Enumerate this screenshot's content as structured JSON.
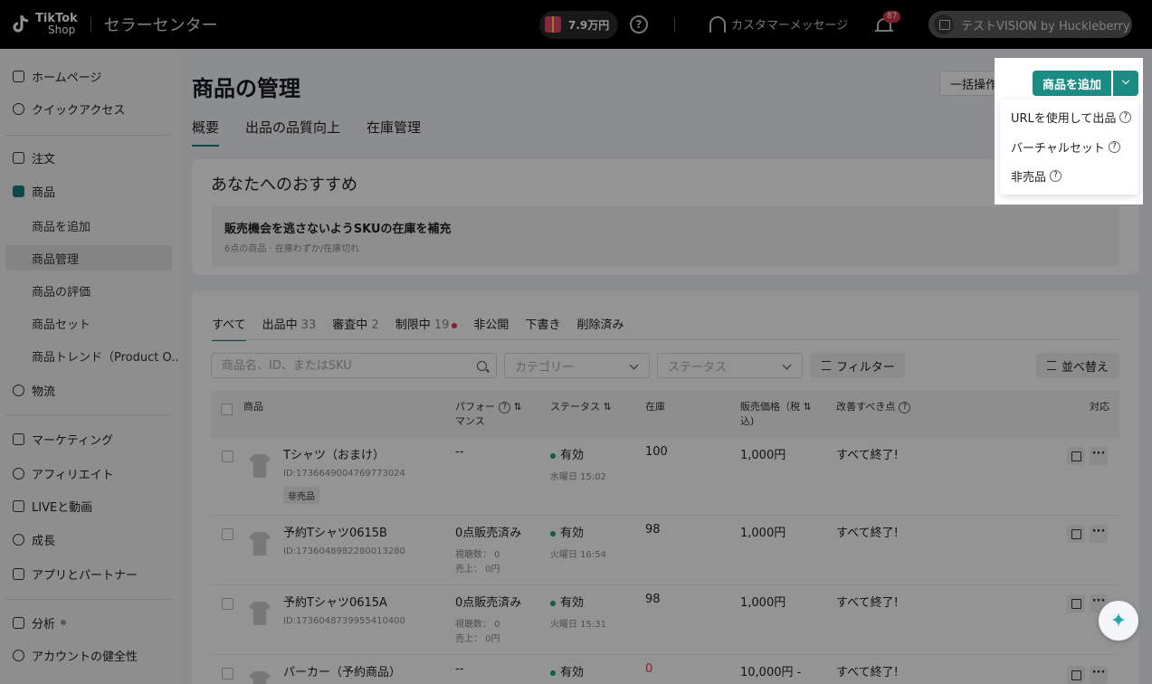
{
  "topbar": {
    "logo_line1": "TikTok",
    "logo_line2": "Shop",
    "center_title": "セラーセンター",
    "balance": "7.9万円",
    "help": "?",
    "customer_messages": "カスタマーメッセージ",
    "notification_count": "87",
    "shop_name": "テストVISION by Huckleberry"
  },
  "sidebar": {
    "home": "ホームページ",
    "quick_access": "クイックアクセス",
    "orders": "注文",
    "products": "商品",
    "sub": {
      "add": "商品を追加",
      "manage": "商品管理",
      "reviews": "商品の評価",
      "sets": "商品セット",
      "trends": "商品トレンド（Product O..."
    },
    "logistics": "物流",
    "marketing": "マーケティング",
    "affiliate": "アフィリエイト",
    "live": "LIVEと動画",
    "growth": "成長",
    "apps": "アプリとパートナー",
    "analytics": "分析",
    "account_health": "アカウントの健全性"
  },
  "main": {
    "title": "商品の管理",
    "bulk_action": "一括操作",
    "add_product": "商品を追加",
    "tabs": [
      "概要",
      "出品の品質向上",
      "在庫管理"
    ],
    "recommend": {
      "title": "あなたへのおすすめ",
      "item_title": "販売機会を逃さないようSKUの在庫を補充",
      "item_sub": "6点の商品 · 在庫わずか/在庫切れ"
    },
    "status_tabs": [
      {
        "label": "すべて",
        "count": ""
      },
      {
        "label": "出品中",
        "count": "33"
      },
      {
        "label": "審査中",
        "count": "2"
      },
      {
        "label": "制限中",
        "count": "19"
      },
      {
        "label": "非公開",
        "count": ""
      },
      {
        "label": "下書き",
        "count": ""
      },
      {
        "label": "削除済み",
        "count": ""
      }
    ],
    "search_placeholder": "商品名、ID、またはSKU",
    "category_placeholder": "カテゴリー",
    "status_placeholder": "ステータス",
    "filter": "フィルター",
    "sort": "並べ替え",
    "columns": {
      "product": "商品",
      "performance_1": "パフォー",
      "performance_2": "マンス",
      "status": "ステータス",
      "stock": "在庫",
      "price_1": "販売価格（税",
      "price_2": "込)",
      "improve": "改善すべき点",
      "action": "対応"
    },
    "rows": [
      {
        "name": "Tシャツ（おまけ）",
        "id": "ID:1736649004769773024",
        "tag": "非売品",
        "perf": "--",
        "perf_views": "",
        "perf_sales": "",
        "status": "有効",
        "status_date": "水曜日 15:02",
        "stock": "100",
        "price": "1,000円",
        "improve": "すべて終了!"
      },
      {
        "name": "予約Tシャツ0615B",
        "id": "ID:1736048982280013280",
        "tag": "",
        "perf": "0点販売済み",
        "perf_views": "視聴数： 0",
        "perf_sales": "売上： 0円",
        "status": "有効",
        "status_date": "火曜日 16:54",
        "stock": "98",
        "price": "1,000円",
        "improve": "すべて終了!"
      },
      {
        "name": "予約Tシャツ0615A",
        "id": "ID:1736048739955410400",
        "tag": "",
        "perf": "0点販売済み",
        "perf_views": "視聴数： 0",
        "perf_sales": "売上： 0円",
        "status": "有効",
        "status_date": "火曜日 15:31",
        "stock": "98",
        "price": "1,000円",
        "improve": "すべて終了!"
      },
      {
        "name": "パーカー（予約商品）",
        "id": "",
        "tag": "",
        "perf": "--",
        "perf_views": "",
        "perf_sales": "",
        "status": "有効",
        "status_date": "",
        "stock": "0",
        "price": "10,000円 -",
        "improve": "すべて終了!"
      }
    ]
  },
  "dropdown": {
    "items": [
      "URLを使用して出品",
      "バーチャルセット",
      "非売品"
    ]
  },
  "colors": {
    "accent": "#1a8c84",
    "active_status": "#1aa36a",
    "stock_zero": "#e8334f"
  }
}
